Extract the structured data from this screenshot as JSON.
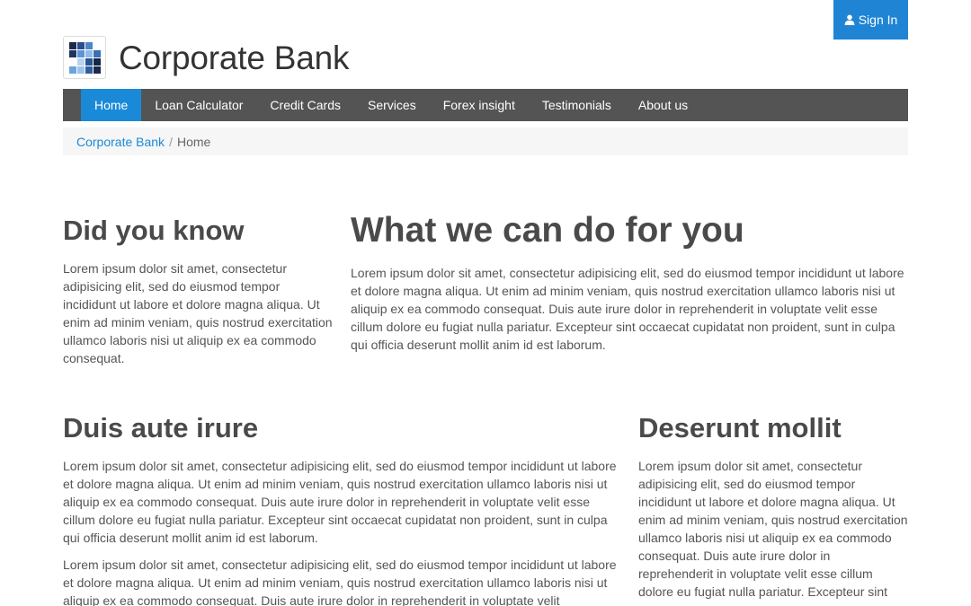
{
  "header": {
    "signin_label": "Sign In",
    "brand_title": "Corporate Bank",
    "logo_icon": "pixel-grid-logo-icon",
    "user_icon": "user-icon"
  },
  "nav": {
    "items": [
      {
        "label": "Home",
        "active": true
      },
      {
        "label": "Loan Calculator"
      },
      {
        "label": "Credit Cards"
      },
      {
        "label": "Services"
      },
      {
        "label": "Forex insight"
      },
      {
        "label": "Testimonials"
      },
      {
        "label": "About us"
      }
    ]
  },
  "breadcrumb": {
    "root": "Corporate Bank",
    "separator": "/",
    "current": "Home"
  },
  "sections": {
    "did_you_know": {
      "title": "Did you know",
      "body": "Lorem ipsum dolor sit amet, consectetur adipisicing elit, sed do eiusmod tempor incididunt ut labore et dolore magna aliqua. Ut enim ad minim veniam, quis nostrud exercitation ullamco laboris nisi ut aliquip ex ea commodo consequat."
    },
    "what_we_can_do": {
      "title": "What we can do for you",
      "body": "Lorem ipsum dolor sit amet, consectetur adipisicing elit, sed do eiusmod tempor incididunt ut labore et dolore magna aliqua. Ut enim ad minim veniam, quis nostrud exercitation ullamco laboris nisi ut aliquip ex ea commodo consequat. Duis aute irure dolor in reprehenderit in voluptate velit esse cillum dolore eu fugiat nulla pariatur. Excepteur sint occaecat cupidatat non proident, sunt in culpa qui officia deserunt mollit anim id est laborum."
    },
    "duis_aute": {
      "title": "Duis aute irure",
      "paragraphs": [
        "Lorem ipsum dolor sit amet, consectetur adipisicing elit, sed do eiusmod tempor incididunt ut labore et dolore magna aliqua. Ut enim ad minim veniam, quis nostrud exercitation ullamco laboris nisi ut aliquip ex ea commodo consequat. Duis aute irure dolor in reprehenderit in voluptate velit esse cillum dolore eu fugiat nulla pariatur. Excepteur sint occaecat cupidatat non proident, sunt in culpa qui officia deserunt mollit anim id est laborum.",
        "Lorem ipsum dolor sit amet, consectetur adipisicing elit, sed do eiusmod tempor incididunt ut labore et dolore magna aliqua. Ut enim ad minim veniam, quis nostrud exercitation ullamco laboris nisi ut aliquip ex ea commodo consequat. Duis aute irure dolor in reprehenderit in voluptate velit"
      ]
    },
    "deserunt_mollit": {
      "title": "Deserunt mollit",
      "body": "Lorem ipsum dolor sit amet, consectetur adipisicing elit, sed do eiusmod tempor incididunt ut labore et dolore magna aliqua. Ut enim ad minim veniam, quis nostrud exercitation ullamco laboris nisi ut aliquip ex ea commodo consequat. Duis aute irure dolor in reprehenderit in voluptate velit esse cillum dolore eu fugiat nulla pariatur. Excepteur sint"
    }
  },
  "colors": {
    "accent": "#1a8ad8",
    "signin_bg": "#1f84d4",
    "navbar_bg": "#545454",
    "breadcrumb_bg": "#f6f6f6",
    "heading": "#4a4a4a",
    "text": "#555555"
  }
}
